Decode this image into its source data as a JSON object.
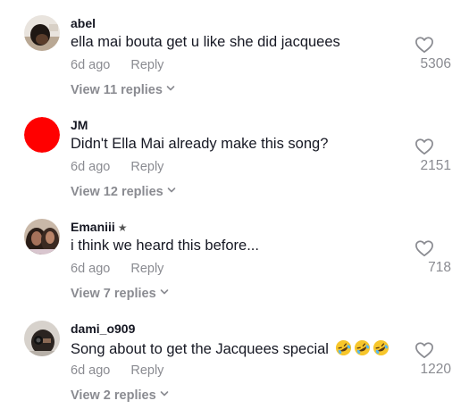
{
  "comments": [
    {
      "username": "abel",
      "text": "ella mai bouta get u like she did jacquees",
      "time": "6d ago",
      "reply": "Reply",
      "view_replies": "View 11 replies",
      "likes": "5306",
      "avatar": "photo"
    },
    {
      "username": "JM",
      "text": "Didn't Ella Mai already make this song?",
      "time": "6d ago",
      "reply": "Reply",
      "view_replies": "View 12 replies",
      "likes": "2151",
      "avatar": "red-circle"
    },
    {
      "username": "Emaniii",
      "username_badge": "★",
      "text": "i think we heard this before...",
      "time": "6d ago",
      "reply": "Reply",
      "view_replies": "View 7 replies",
      "likes": "718",
      "avatar": "photo"
    },
    {
      "username": "dami_o909",
      "text": "Song about to get the Jacquees special",
      "emojis": [
        "rolling-on-floor-laughing-emoji",
        "rolling-on-floor-laughing-emoji",
        "rolling-on-floor-laughing-emoji"
      ],
      "time": "6d ago",
      "reply": "Reply",
      "view_replies": "View 2 replies",
      "likes": "1220",
      "avatar": "photo"
    }
  ],
  "colors": {
    "primary_text": "#161823",
    "secondary_text": "#8a8b91",
    "jm_avatar": "#ff0000"
  },
  "icons": {
    "like": "heart-outline-icon",
    "expand": "chevron-down-icon"
  }
}
